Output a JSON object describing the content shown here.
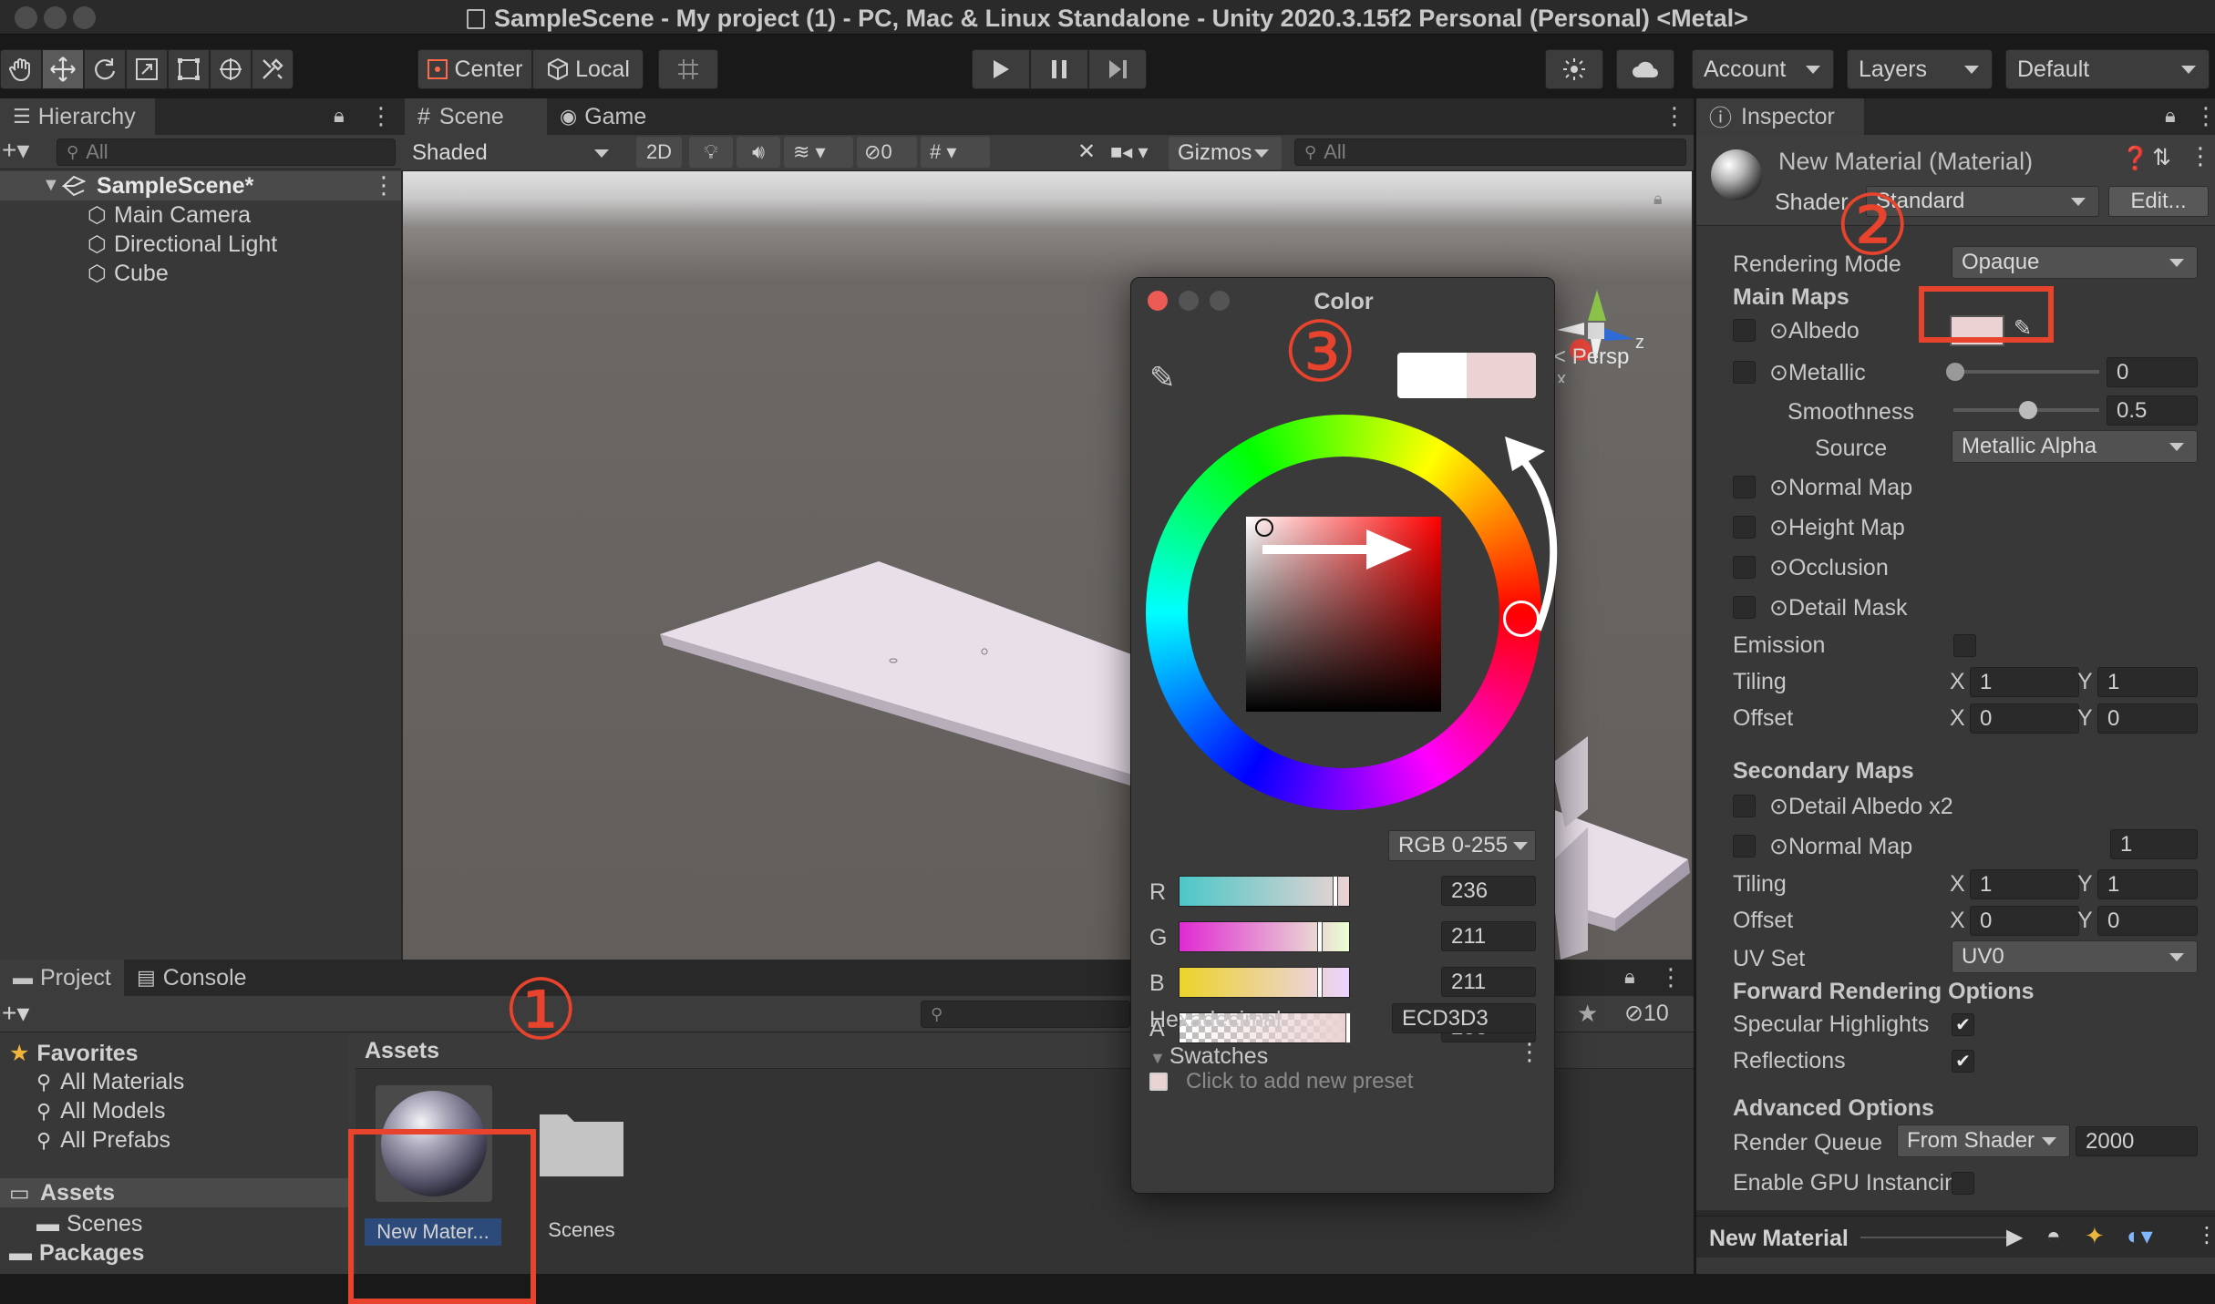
{
  "window": {
    "title": "SampleScene - My project (1) - PC, Mac & Linux Standalone - Unity 2020.3.15f2 Personal (Personal) <Metal>"
  },
  "toolbar": {
    "center_label": "Center",
    "local_label": "Local",
    "account_label": "Account",
    "layers_label": "Layers",
    "layout_label": "Default"
  },
  "hierarchy": {
    "tab_label": "Hierarchy",
    "search_placeholder": "All",
    "scene_name": "SampleScene*",
    "items": [
      "Main Camera",
      "Directional Light",
      "Cube"
    ]
  },
  "scene_view": {
    "tab_scene": "Scene",
    "tab_game": "Game",
    "shading_mode": "Shaded",
    "mode_2d": "2D",
    "hidden_count": "0",
    "gizmos_label": "Gizmos",
    "search_placeholder": "All",
    "persp_label": "Persp",
    "gizmo_x": "x",
    "gizmo_z": "z"
  },
  "color_picker": {
    "title": "Color",
    "mode": "RGB 0-255",
    "channels": [
      {
        "label": "R",
        "value": "236",
        "fraction": 0.925
      },
      {
        "label": "G",
        "value": "211",
        "fraction": 0.827
      },
      {
        "label": "B",
        "value": "211",
        "fraction": 0.827
      },
      {
        "label": "A",
        "value": "255",
        "fraction": 1.0
      }
    ],
    "hex_label": "Hexadecimal",
    "hex_value": "ECD3D3",
    "swatches_label": "Swatches",
    "swatches_hint": "Click to add new preset",
    "current_color": "#ECD3D3",
    "previous_color": "#FFFFFF"
  },
  "annotations": {
    "step1": "①",
    "step2": "②",
    "step3": "③",
    "highlight_color": "#E8432C"
  },
  "project": {
    "tab_project": "Project",
    "tab_console": "Console",
    "favorites_label": "Favorites",
    "favorites": [
      "All Materials",
      "All Models",
      "All Prefabs"
    ],
    "assets_label": "Assets",
    "asset_folders": [
      "Scenes"
    ],
    "packages_label": "Packages",
    "breadcrumb": "Assets",
    "hidden_count": "10",
    "material_item": "New Mater...",
    "folder_item": "Scenes"
  },
  "inspector": {
    "tab_label": "Inspector",
    "material_name": "New Material (Material)",
    "shader_label": "Shader",
    "shader_value": "Standard",
    "edit_label": "Edit...",
    "rendering_mode_label": "Rendering Mode",
    "rendering_mode_value": "Opaque",
    "main_maps_label": "Main Maps",
    "albedo_label": "Albedo",
    "albedo_color": "#ECD3D3",
    "metallic_label": "Metallic",
    "metallic_value": "0",
    "metallic_fraction": 0.0,
    "smoothness_label": "Smoothness",
    "smoothness_value": "0.5",
    "smoothness_fraction": 0.5,
    "source_label": "Source",
    "source_value": "Metallic Alpha",
    "normal_map_label": "Normal Map",
    "height_map_label": "Height Map",
    "occlusion_label": "Occlusion",
    "detail_mask_label": "Detail Mask",
    "emission_label": "Emission",
    "tiling_label": "Tiling",
    "offset_label": "Offset",
    "x_label": "X",
    "y_label": "Y",
    "tiling_x": "1",
    "tiling_y": "1",
    "offset_x": "0",
    "offset_y": "0",
    "secondary_maps_label": "Secondary Maps",
    "detail_albedo_label": "Detail Albedo x2",
    "sec_normal_map_label": "Normal Map",
    "sec_normal_value": "1",
    "sec_tiling_x": "1",
    "sec_tiling_y": "1",
    "sec_offset_x": "0",
    "sec_offset_y": "0",
    "uv_set_label": "UV Set",
    "uv_set_value": "UV0",
    "forward_label": "Forward Rendering Options",
    "specular_label": "Specular Highlights",
    "reflections_label": "Reflections",
    "advanced_label": "Advanced Options",
    "render_queue_label": "Render Queue",
    "render_queue_mode": "From Shader",
    "render_queue_value": "2000",
    "gpu_instancing_label": "Enable GPU Instancin",
    "preview_label": "New Material"
  }
}
